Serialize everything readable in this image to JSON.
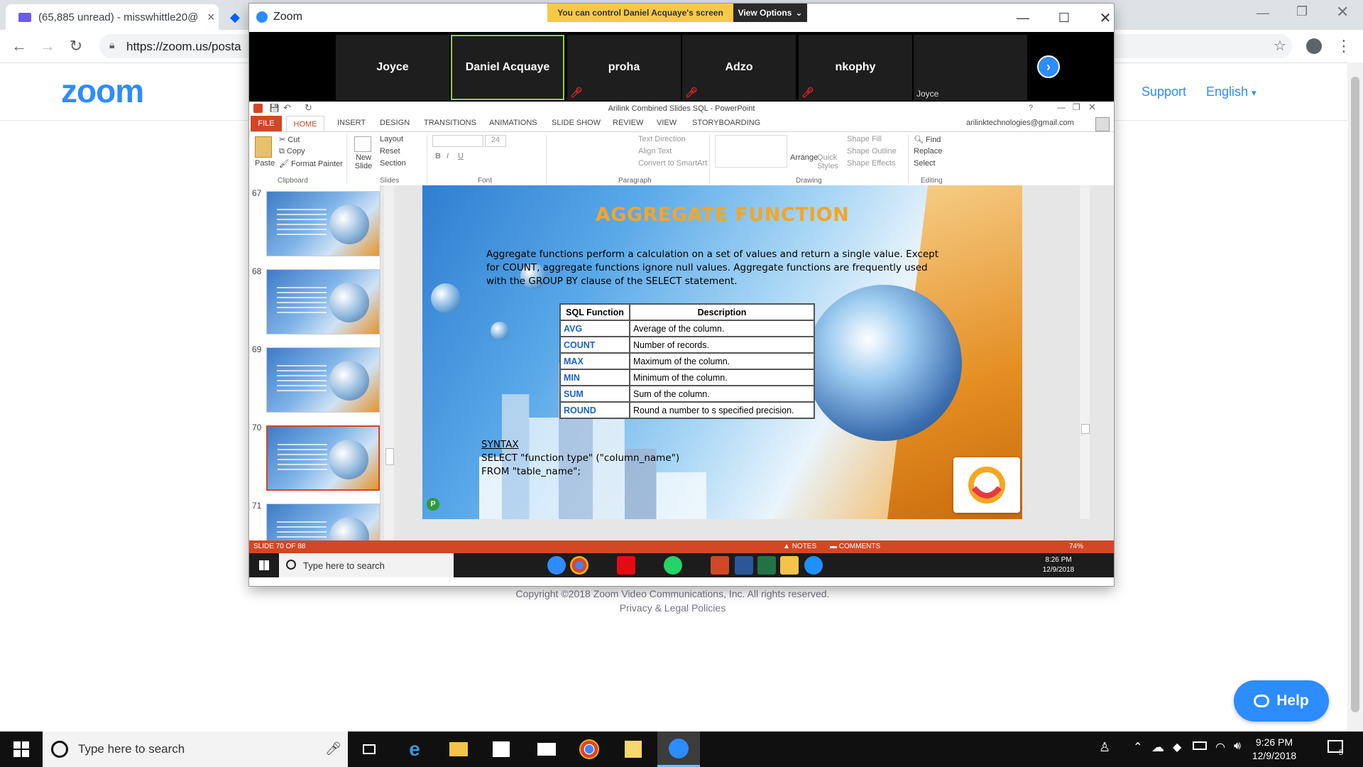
{
  "browser": {
    "tabs": [
      {
        "label": "(65,885 unread) - misswhittle20@"
      },
      {
        "label": ""
      }
    ],
    "url": "https://zoom.us/postattendee",
    "url_visible": "https://zoom.us/posta"
  },
  "site": {
    "logo": "zoom",
    "support_link": "Support",
    "language_link": "English",
    "copyright": "Copyright ©2018 Zoom Video Communications, Inc. All rights reserved.",
    "footer_links": "Privacy & Legal Policies",
    "help_button": "Help"
  },
  "zoom": {
    "window_title": "Zoom",
    "control_banner": "You can control Daniel Acquaye's screen",
    "view_options": "View Options",
    "participants": [
      {
        "name": "Joyce",
        "speaking": false,
        "muted": false
      },
      {
        "name": "Daniel Acquaye",
        "speaking": true,
        "muted": true
      },
      {
        "name": "proha",
        "speaking": false,
        "muted": true
      },
      {
        "name": "Adzo",
        "speaking": false,
        "muted": true
      },
      {
        "name": "nkophy",
        "speaking": false,
        "muted": false
      },
      {
        "name": "",
        "label": "Joyce",
        "speaking": false,
        "muted": false
      }
    ]
  },
  "ppt": {
    "doc_title": "Arilink Combined Slides SQL - PowerPoint",
    "file_tab": "FILE",
    "tabs": [
      "HOME",
      "INSERT",
      "DESIGN",
      "TRANSITIONS",
      "ANIMATIONS",
      "SLIDE SHOW",
      "REVIEW",
      "VIEW",
      "STORYBOARDING"
    ],
    "account": "arilinktechnologies@gmail.com",
    "ribbon": {
      "paste": "Paste",
      "cut": "Cut",
      "copy": "Copy",
      "format_painter": "Format Painter",
      "clipboard": "Clipboard",
      "new_slide": "New Slide",
      "layout": "Layout",
      "reset": "Reset",
      "section": "Section",
      "slides": "Slides",
      "font_size": "24",
      "font": "Font",
      "text_direction": "Text Direction",
      "align_text": "Align Text",
      "convert_smartart": "Convert to SmartArt",
      "paragraph": "Paragraph",
      "arrange": "Arrange",
      "quick_styles": "Quick Styles",
      "shape_fill": "Shape Fill",
      "shape_outline": "Shape Outline",
      "shape_effects": "Shape Effects",
      "drawing": "Drawing",
      "find": "Find",
      "replace": "Replace",
      "select": "Select",
      "editing": "Editing"
    },
    "thumbnails": [
      {
        "num": "67",
        "selected": false
      },
      {
        "num": "68",
        "selected": false
      },
      {
        "num": "69",
        "selected": false
      },
      {
        "num": "70",
        "selected": true
      },
      {
        "num": "71",
        "selected": false
      }
    ],
    "slide": {
      "title": "AGGREGATE FUNCTION",
      "intro": "Aggregate functions perform a calculation on a set of values and return a single value. Except for COUNT, aggregate functions ignore null values. Aggregate functions are frequently used with the GROUP BY clause of the SELECT statement.",
      "table_headers": [
        "SQL Function",
        "Description"
      ],
      "table_rows": [
        {
          "fn": "AVG",
          "desc": "Average of the column."
        },
        {
          "fn": "COUNT",
          "desc": "Number of records."
        },
        {
          "fn": "MAX",
          "desc": "Maximum of the column."
        },
        {
          "fn": "MIN",
          "desc": "Minimum of the column."
        },
        {
          "fn": "SUM",
          "desc": "Sum of the column."
        },
        {
          "fn": "ROUND",
          "desc": "Round a number to s specified precision."
        }
      ],
      "syntax_label": "SYNTAX",
      "syntax_line1": "SELECT \"function type\" (\"column_name\")",
      "syntax_line2": "FROM \"table_name\";",
      "badge": "P"
    },
    "status": {
      "slide_counter": "SLIDE 70 OF 88",
      "notes": "NOTES",
      "comments": "COMMENTS",
      "zoom_pct": "74%"
    },
    "remote_taskbar": {
      "search_placeholder": "Type here to search",
      "time": "8:26 PM",
      "date": "12/9/2018"
    }
  },
  "taskbar": {
    "search_placeholder": "Type here to search",
    "time": "9:26 PM",
    "date": "12/9/2018",
    "notification_count": "5"
  },
  "colors": {
    "zoom_blue": "#2d8cff",
    "ppt_orange": "#d24726",
    "banner_yellow": "#f7c948",
    "speaker_border": "#8fd14f"
  }
}
